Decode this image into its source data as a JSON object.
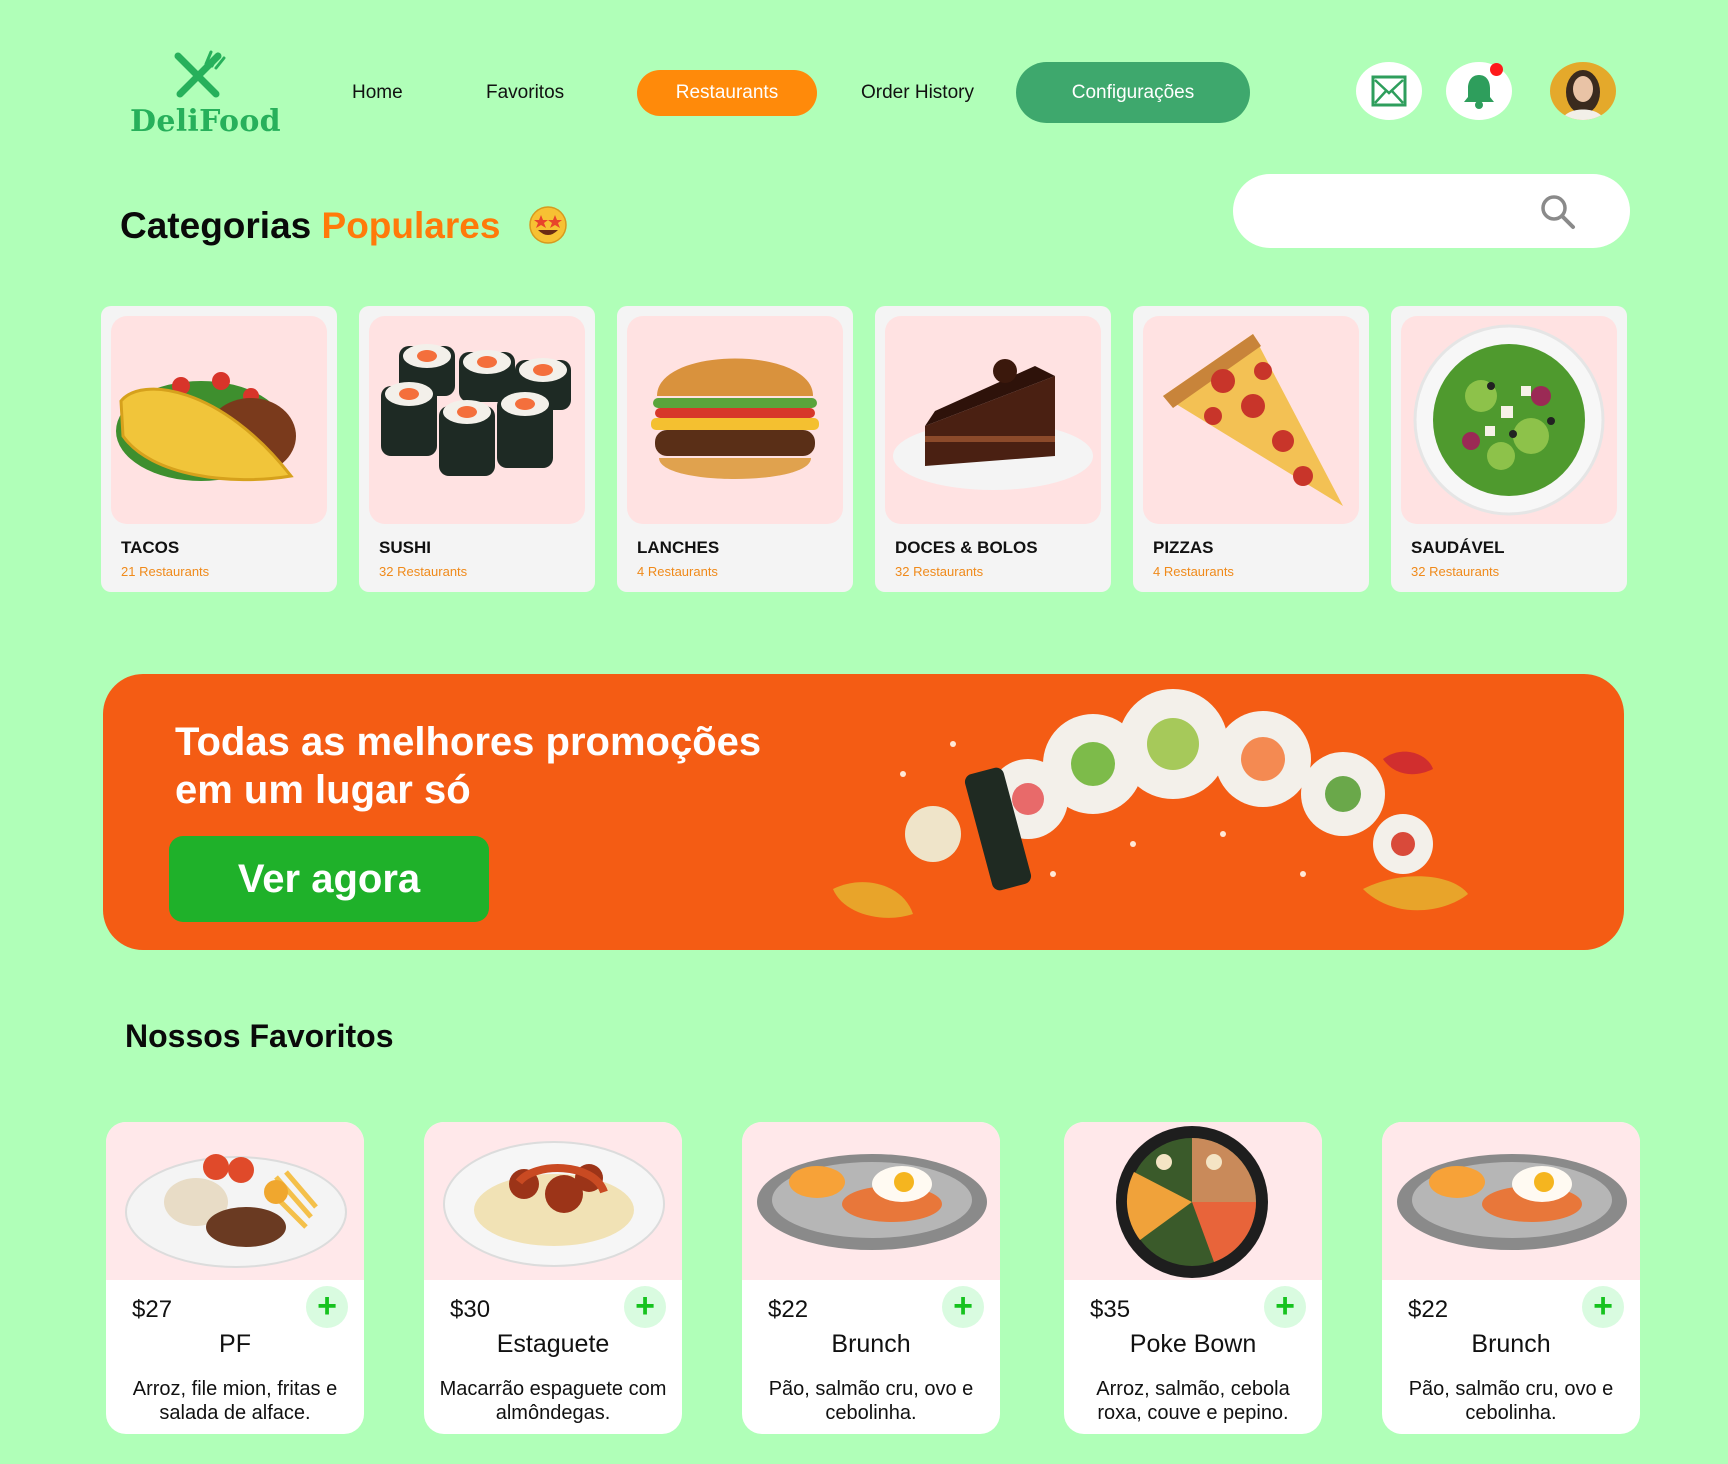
{
  "brand": {
    "name": "DeliFood",
    "accent": "#27b05b"
  },
  "nav": {
    "home": "Home",
    "favoritos": "Favoritos",
    "restaurants": "Restaurants",
    "order_history": "Order History",
    "configuracoes": "Configurações"
  },
  "header_icons": {
    "mail": "mail-icon",
    "notifications": "bell-icon",
    "avatar": "user-avatar"
  },
  "section": {
    "title_main": "Categorias",
    "title_accent": "Populares",
    "emoji": "star-struck-emoji"
  },
  "search": {
    "placeholder": ""
  },
  "categories": [
    {
      "name": "TACOS",
      "count": "21 Restaurants"
    },
    {
      "name": "SUSHI",
      "count": "32 Restaurants"
    },
    {
      "name": "LANCHES",
      "count": "4 Restaurants"
    },
    {
      "name": "DOCES & BOLOS",
      "count": "32 Restaurants"
    },
    {
      "name": "PIZZAS",
      "count": "4 Restaurants"
    },
    {
      "name": "SAUDÁVEL",
      "count": "32 Restaurants"
    }
  ],
  "banner": {
    "title": "Todas as melhores promoções em um lugar só",
    "button": "Ver agora"
  },
  "favorites": {
    "title": "Nossos Favoritos",
    "items": [
      {
        "price": "$27",
        "name": "PF",
        "desc": "Arroz, file mion, fritas e salada de alface."
      },
      {
        "price": "$30",
        "name": "Estaguete",
        "desc": "Macarrão espaguete com almôndegas."
      },
      {
        "price": "$22",
        "name": "Brunch",
        "desc": "Pão, salmão cru, ovo e cebolinha."
      },
      {
        "price": "$35",
        "name": "Poke Bown",
        "desc": "Arroz, salmão, cebola roxa, couve e pepino."
      },
      {
        "price": "$22",
        "name": "Brunch",
        "desc": "Pão, salmão cru, ovo e cebolinha."
      }
    ],
    "add_label": "+"
  },
  "colors": {
    "background": "#b0ffb8",
    "orange": "#ff8a0a",
    "banner": "#f45c14",
    "green_button": "#1fb12a",
    "config_button": "#3ea86d"
  }
}
